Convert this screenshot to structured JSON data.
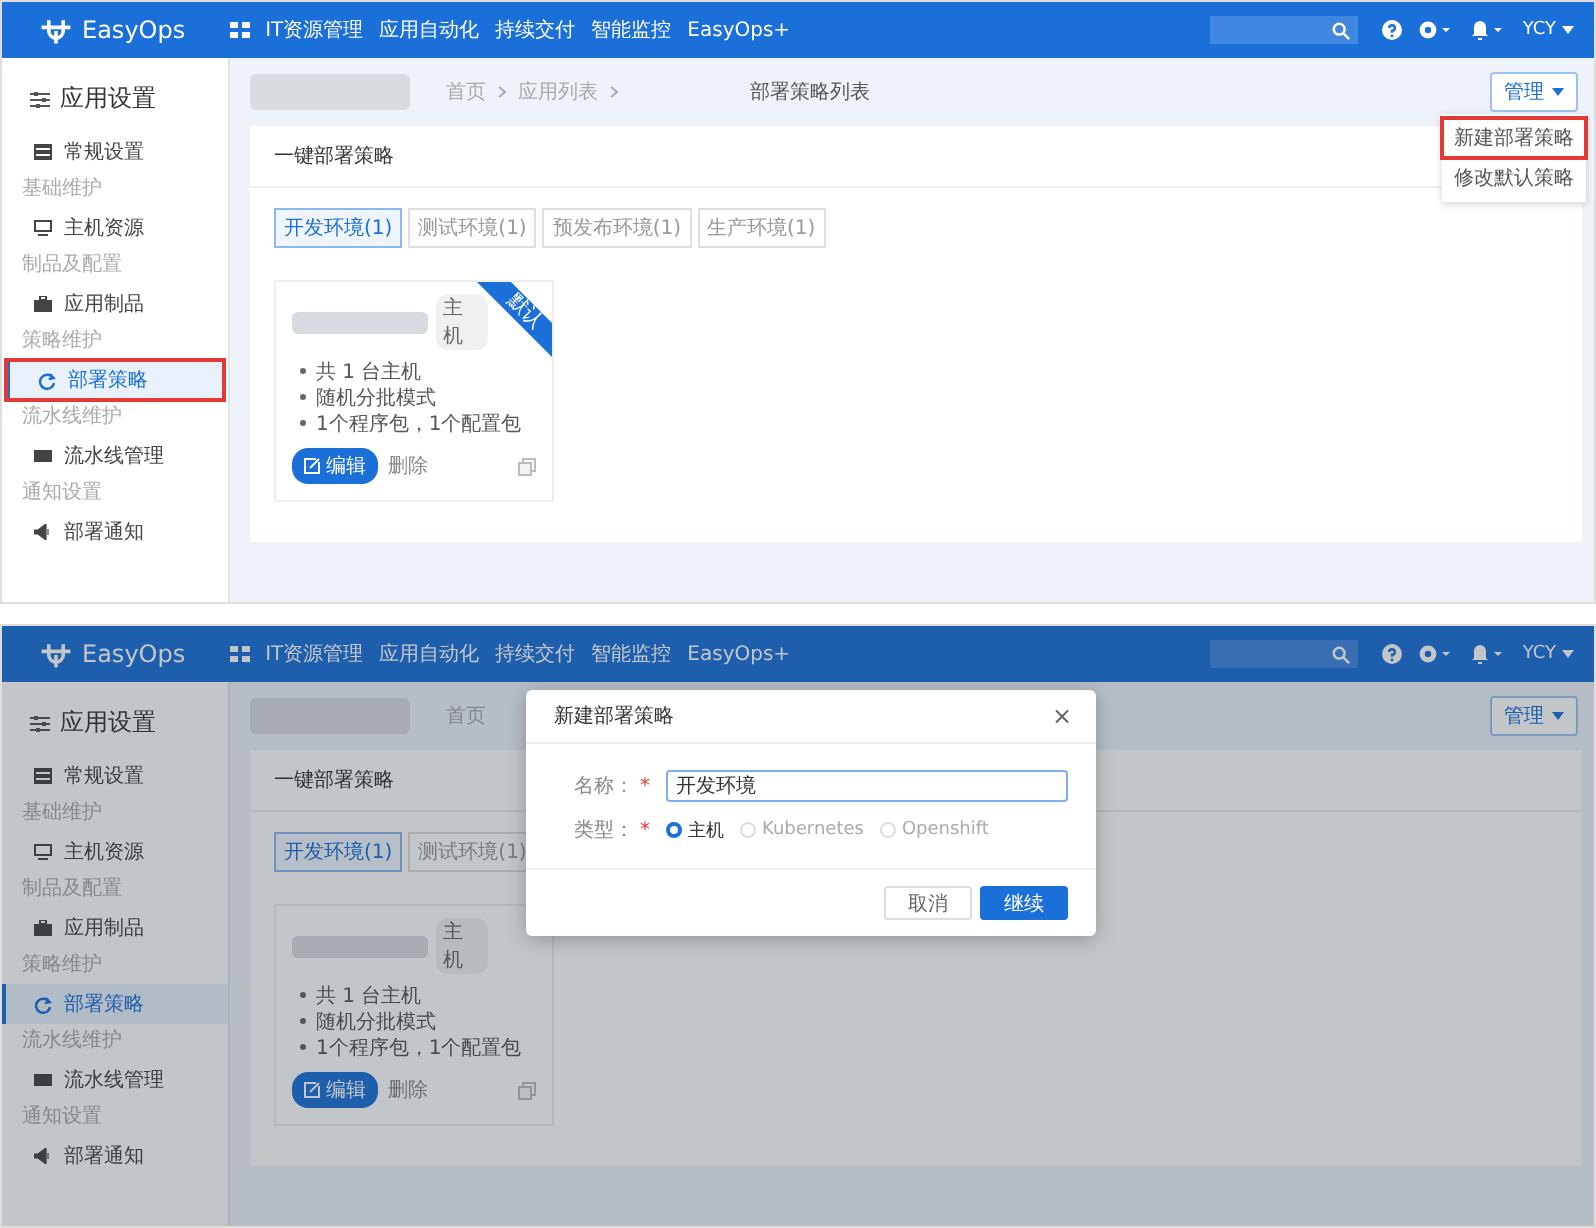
{
  "screens": [
    {
      "nav": {
        "logo": "EasyOps",
        "items": [
          "IT资源管理",
          "应用自动化",
          "持续交付",
          "智能监控",
          "EasyOps+"
        ],
        "user": "YCY"
      },
      "sidebar": {
        "title": "应用设置",
        "items": [
          {
            "kind": "item",
            "label": "常规设置",
            "selected": false,
            "highlighted": false
          },
          {
            "kind": "group",
            "label": "基础维护"
          },
          {
            "kind": "item",
            "label": "主机资源",
            "selected": false,
            "highlighted": false
          },
          {
            "kind": "group",
            "label": "制品及配置"
          },
          {
            "kind": "item",
            "label": "应用制品",
            "selected": false,
            "highlighted": false
          },
          {
            "kind": "group",
            "label": "策略维护"
          },
          {
            "kind": "item",
            "label": "部署策略",
            "selected": true,
            "highlighted": true
          },
          {
            "kind": "group",
            "label": "流水线维护"
          },
          {
            "kind": "item",
            "label": "流水线管理",
            "selected": false,
            "highlighted": false
          },
          {
            "kind": "group",
            "label": "通知设置"
          },
          {
            "kind": "item",
            "label": "部署通知",
            "selected": false,
            "highlighted": false
          }
        ]
      },
      "breadcrumb": [
        "首页",
        "应用列表",
        "部署策略列表"
      ],
      "manage_button": "管理",
      "dropdown": {
        "items": [
          {
            "label": "新建部署策略",
            "highlighted": true
          },
          {
            "label": "修改默认策略",
            "highlighted": false
          }
        ]
      },
      "panel": {
        "title": "一键部署策略",
        "tabs": [
          {
            "label": "开发环境(1)",
            "selected": true
          },
          {
            "label": "测试环境(1)",
            "selected": false
          },
          {
            "label": "预发布环境(1)",
            "selected": false
          },
          {
            "label": "生产环境(1)",
            "selected": false
          }
        ],
        "card": {
          "tag": "主机",
          "ribbon": "默认",
          "bullets": [
            "共 1 台主机",
            "随机分批模式",
            "1个程序包，1个配置包"
          ],
          "edit": "编辑",
          "delete": "删除"
        }
      }
    },
    {
      "nav": {
        "logo": "EasyOps",
        "items": [
          "IT资源管理",
          "应用自动化",
          "持续交付",
          "智能监控",
          "EasyOps+"
        ],
        "user": "YCY"
      },
      "sidebar": {
        "title": "应用设置",
        "items": [
          {
            "kind": "item",
            "label": "常规设置",
            "selected": false,
            "highlighted": false
          },
          {
            "kind": "group",
            "label": "基础维护"
          },
          {
            "kind": "item",
            "label": "主机资源",
            "selected": false,
            "highlighted": false
          },
          {
            "kind": "group",
            "label": "制品及配置"
          },
          {
            "kind": "item",
            "label": "应用制品",
            "selected": false,
            "highlighted": false
          },
          {
            "kind": "group",
            "label": "策略维护"
          },
          {
            "kind": "item",
            "label": "部署策略",
            "selected": true,
            "highlighted": false
          },
          {
            "kind": "group",
            "label": "流水线维护"
          },
          {
            "kind": "item",
            "label": "流水线管理",
            "selected": false,
            "highlighted": false
          },
          {
            "kind": "group",
            "label": "通知设置"
          },
          {
            "kind": "item",
            "label": "部署通知",
            "selected": false,
            "highlighted": false
          }
        ]
      },
      "breadcrumb": [
        "首页"
      ],
      "manage_button": "管理",
      "panel": {
        "title": "一键部署策略",
        "tabs": [
          {
            "label": "开发环境(1)",
            "selected": true
          },
          {
            "label": "测试环境(1)",
            "selected": false
          }
        ],
        "card": {
          "tag": "主机",
          "bullets": [
            "共 1 台主机",
            "随机分批模式",
            "1个程序包，1个配置包"
          ],
          "edit": "编辑",
          "delete": "删除"
        }
      },
      "modal": {
        "title": "新建部署策略",
        "close": "×",
        "fields": [
          {
            "kind": "input",
            "label": "名称：",
            "required_mark": "*",
            "value": "开发环境"
          },
          {
            "kind": "radio",
            "label": "类型：",
            "required_mark": "*",
            "options": [
              {
                "label": "主机",
                "selected": true
              },
              {
                "label": "Kubernetes",
                "selected": false
              },
              {
                "label": "Openshift",
                "selected": false
              }
            ]
          }
        ],
        "buttons": [
          {
            "label": "取消",
            "primary": false
          },
          {
            "label": "继续",
            "primary": true
          }
        ]
      }
    }
  ]
}
